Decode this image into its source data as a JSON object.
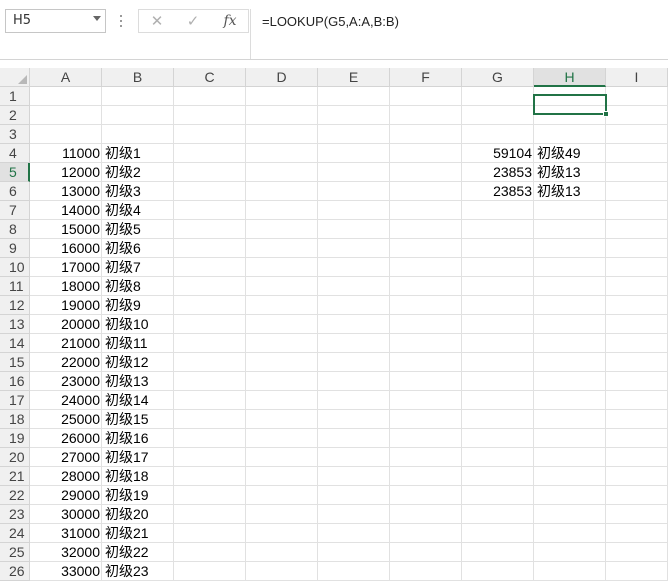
{
  "namebox": {
    "value": "H5"
  },
  "formula_bar": {
    "cancel_icon": "✕",
    "enter_icon": "✓",
    "fx_label": "fx",
    "formula": "=LOOKUP(G5,A:A,B:B)"
  },
  "columns": [
    "A",
    "B",
    "C",
    "D",
    "E",
    "F",
    "G",
    "H",
    "I"
  ],
  "rows": [
    "1",
    "2",
    "3",
    "4",
    "5",
    "6",
    "7",
    "8",
    "9",
    "10",
    "11",
    "12",
    "13",
    "14",
    "15",
    "16",
    "17",
    "18",
    "19",
    "20",
    "21",
    "22",
    "23",
    "24",
    "25",
    "26"
  ],
  "selected": {
    "column": "H",
    "row": "5"
  },
  "cells": {
    "A": [
      "",
      "",
      "",
      "11000",
      "12000",
      "13000",
      "14000",
      "15000",
      "16000",
      "17000",
      "18000",
      "19000",
      "20000",
      "21000",
      "22000",
      "23000",
      "24000",
      "25000",
      "26000",
      "27000",
      "28000",
      "29000",
      "30000",
      "31000",
      "32000",
      "33000"
    ],
    "B": [
      "",
      "",
      "",
      "初级1",
      "初级2",
      "初级3",
      "初级4",
      "初级5",
      "初级6",
      "初级7",
      "初级8",
      "初级9",
      "初级10",
      "初级11",
      "初级12",
      "初级13",
      "初级14",
      "初级15",
      "初级16",
      "初级17",
      "初级18",
      "初级19",
      "初级20",
      "初级21",
      "初级22",
      "初级23"
    ],
    "G": [
      "",
      "",
      "",
      "59104",
      "23853",
      "23853"
    ],
    "H": [
      "",
      "",
      "",
      "初级49",
      "初级13",
      "初级13"
    ]
  }
}
